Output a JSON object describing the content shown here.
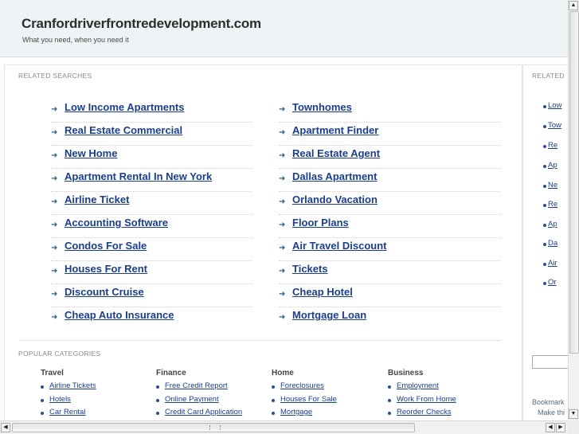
{
  "header": {
    "site_title": "Cranfordriverfrontredevelopment.com",
    "tagline": "What you need, when you need it"
  },
  "related": {
    "label": "RELATED SEARCHES",
    "left": [
      "Low Income Apartments",
      "Real Estate Commercial",
      "New Home",
      "Apartment Rental In New York",
      "Airline Ticket",
      "Accounting Software",
      "Condos For Sale",
      "Houses For Rent",
      "Discount Cruise",
      "Cheap Auto Insurance"
    ],
    "right": [
      "Townhomes",
      "Apartment Finder",
      "Real Estate Agent",
      "Dallas Apartment",
      "Orlando Vacation",
      "Floor Plans",
      "Air Travel Discount",
      "Tickets",
      "Cheap Hotel",
      "Mortgage Loan"
    ]
  },
  "popular": {
    "label": "POPULAR CATEGORIES",
    "columns": [
      {
        "title": "Travel",
        "items": [
          "Airline Tickets",
          "Hotels",
          "Car Rental"
        ]
      },
      {
        "title": "Finance",
        "items": [
          "Free Credit Report",
          "Online Payment",
          "Credit Card Application"
        ]
      },
      {
        "title": "Home",
        "items": [
          "Foreclosures",
          "Houses For Sale",
          "Mortgage"
        ]
      },
      {
        "title": "Business",
        "items": [
          "Employment",
          "Work From Home",
          "Reorder Checks"
        ]
      }
    ]
  },
  "sidebar": {
    "label": "RELATED",
    "items": [
      "Low",
      "Tow",
      "Re",
      "Ap",
      "Ne",
      "Re",
      "Ap",
      "Da",
      "Air",
      "Or"
    ],
    "bookmark_line1": "Bookmark",
    "bookmark_line2": "Make thi"
  },
  "colors": {
    "link": "#1a3e8c",
    "header_bg": "#eef3f5",
    "arrow": "#25628a"
  }
}
